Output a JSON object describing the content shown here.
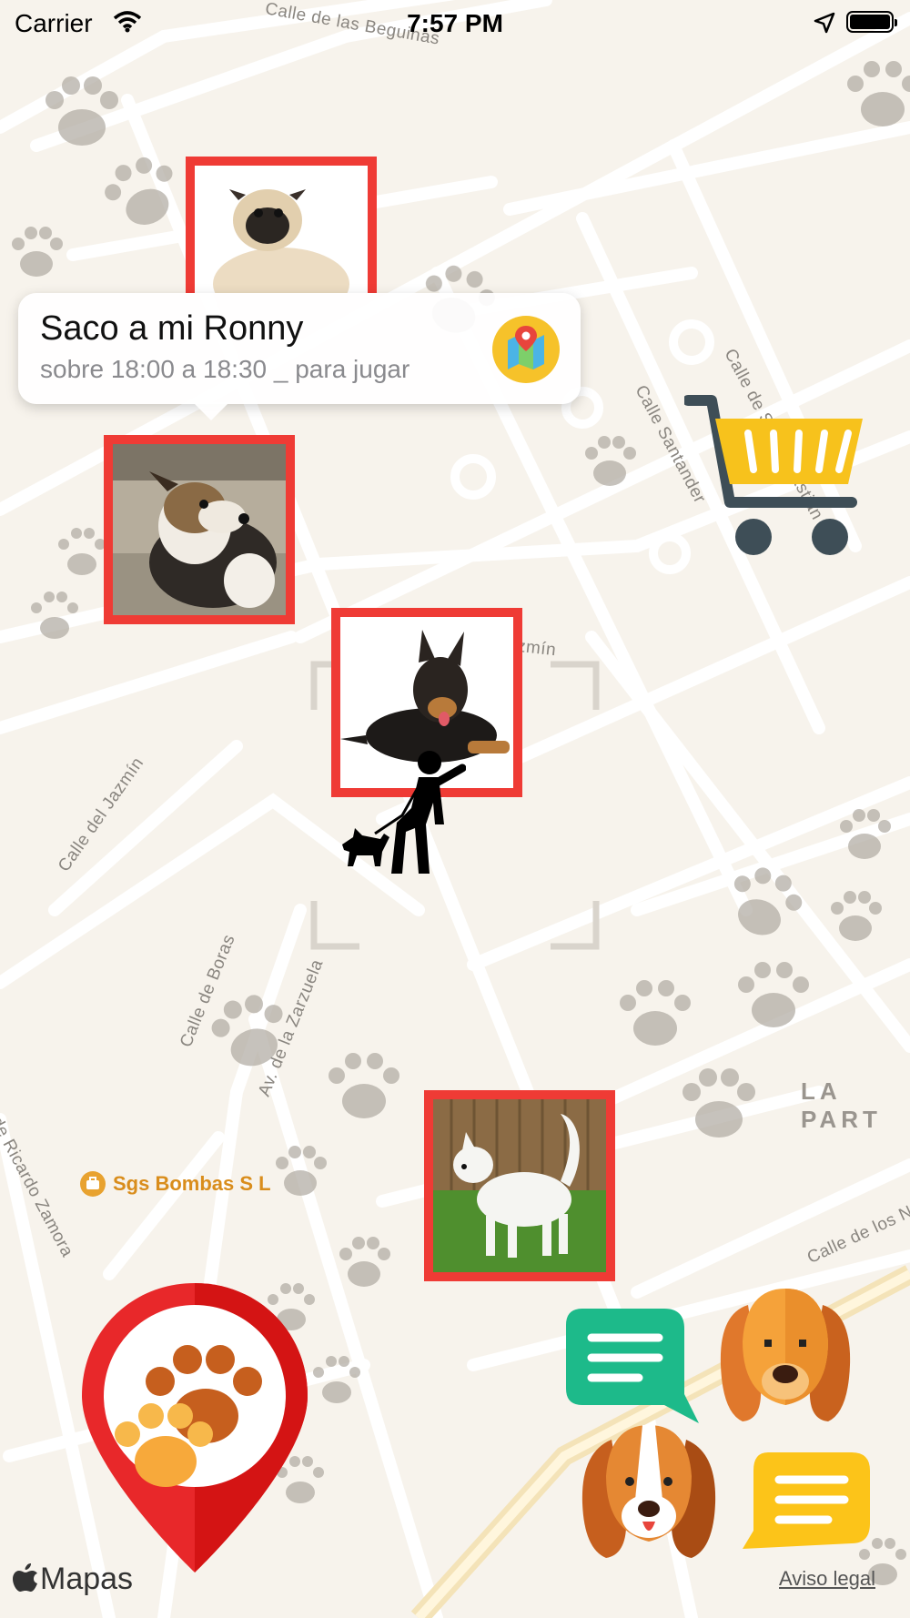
{
  "status_bar": {
    "carrier": "Carrier",
    "time": "7:57 PM"
  },
  "map": {
    "streets": {
      "beguinas": "Calle de las Beguinas",
      "san_sebastian": "Calle de San Sebastián",
      "santander": "Calle Santander",
      "jazmin_fragment": "zmín",
      "jazmin": "Calle del Jazmín",
      "boras": "Calle de Boras",
      "zarzuela": "Av. de la Zarzuela",
      "ricardo_zamora": "de Ricardo Zamora",
      "los_na": "Calle de los Na"
    },
    "district": "LA PART",
    "poi": "Sgs Bombas S L",
    "attribution": "Mapas",
    "legal_link": "Aviso legal"
  },
  "callout": {
    "title": "Saco a mi Ronny",
    "subtitle": "sobre 18:00 a 18:30 _ para jugar",
    "maps_button_icon": "maps-app-icon"
  },
  "pins": [
    {
      "icon": "pug-photo"
    },
    {
      "icon": "shepherd-mix-photo"
    },
    {
      "icon": "german-shepherd-photo"
    },
    {
      "icon": "white-dog-photo"
    }
  ],
  "controls": {
    "shopping_cart_icon": "shopping-cart-icon",
    "paw_pin_icon": "paw-location-pin-icon",
    "chat_green_icon": "chat-bubble-green-icon",
    "dog_face_1_icon": "dog-face-icon",
    "dog_face_2_icon": "beagle-face-icon",
    "chat_yellow_icon": "chat-bubble-yellow-icon",
    "walker_icon": "person-walking-dog-icon"
  },
  "colors": {
    "pin_border": "#ef3b35",
    "map_bg": "#f7f3ec",
    "cart_yellow": "#f7c21c",
    "chat_green": "#1dba8a",
    "chat_yellow": "#fcc419"
  }
}
